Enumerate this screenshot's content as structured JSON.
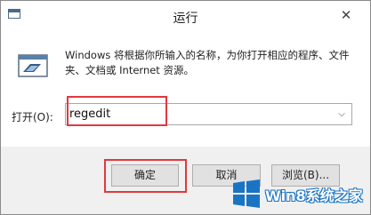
{
  "window": {
    "title": "运行",
    "close_glyph": "✕"
  },
  "content": {
    "description": "Windows 将根据你所输入的名称，为你打开相应的程序、文件夹、文档或 Internet 资源。",
    "open_label": "打开(O):",
    "command_value": "regedit",
    "dropdown_glyph": "⌵"
  },
  "buttons": {
    "ok": "确定",
    "cancel": "取消",
    "browse": "浏览(B)..."
  },
  "watermark": {
    "text": "Win8系统之家"
  },
  "colors": {
    "highlight_box": "#e0393e",
    "watermark_blue": "#1a74c4",
    "dialog_bg": "#f0f0f0"
  }
}
